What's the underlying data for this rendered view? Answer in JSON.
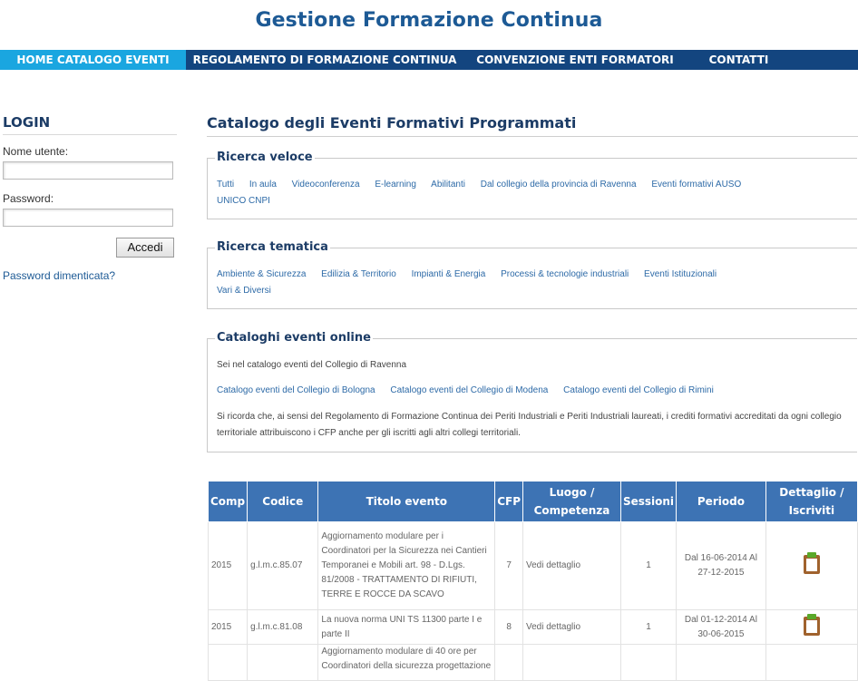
{
  "header": {
    "title": "Gestione Formazione Continua"
  },
  "nav": {
    "items": [
      {
        "label": "HOME CATALOGO EVENTI"
      },
      {
        "label": "REGOLAMENTO DI FORMAZIONE CONTINUA"
      },
      {
        "label": "CONVENZIONE ENTI FORMATORI"
      },
      {
        "label": "CONTATTI"
      }
    ],
    "active_color": "#1aa6e0",
    "bar_color": "#13457f"
  },
  "login": {
    "title": "LOGIN",
    "username_label": "Nome utente:",
    "username_value": "",
    "password_label": "Password:",
    "password_value": "",
    "submit_label": "Accedi",
    "forgot_label": "Password dimenticata?"
  },
  "main": {
    "title": "Catalogo degli Eventi Formativi Programmati",
    "quick_search": {
      "legend": "Ricerca veloce",
      "links": [
        "Tutti",
        "In aula",
        "Videoconferenza",
        "E-learning",
        "Abilitanti",
        "Dal collegio della provincia di Ravenna",
        "Eventi formativi AUSO",
        "UNICO CNPI"
      ]
    },
    "thematic_search": {
      "legend": "Ricerca tematica",
      "links": [
        "Ambiente & Sicurezza",
        "Edilizia & Territorio",
        "Impianti & Energia",
        "Processi & tecnologie industriali",
        "Eventi Istituzionali",
        "Vari & Diversi"
      ]
    },
    "online_catalogs": {
      "legend": "Cataloghi eventi online",
      "intro": "Sei nel catalogo eventi del Collegio di Ravenna",
      "links": [
        "Catalogo eventi del Collegio di Bologna",
        "Catalogo eventi del Collegio di Modena",
        "Catalogo eventi del Collegio di Rimini"
      ],
      "note": "Si ricorda che, ai sensi del Regolamento di Formazione Continua dei Periti Industriali e Periti Industriali laureati, i crediti formativi accreditati da ogni collegio territoriale attribuiscono i CFP anche per gli iscritti agli altri collegi territoriali."
    }
  },
  "table": {
    "headers": [
      "Comp",
      "Codice",
      "Titolo evento",
      "CFP",
      "Luogo / Competenza",
      "Sessioni",
      "Periodo",
      "Dettaglio / Iscriviti"
    ],
    "rows": [
      {
        "comp": "2015",
        "codice": "g.l.m.c.85.07",
        "titolo": "Aggiornamento modulare per i Coordinatori per la Sicurezza nei Cantieri Temporanei e Mobili art. 98 - D.Lgs. 81/2008 - TRATTAMENTO DI RIFIUTI, TERRE E ROCCE DA SCAVO",
        "cfp": "7",
        "luogo": "Vedi dettaglio",
        "sessioni": "1",
        "periodo": "Dal 16-06-2014 Al 27-12-2015"
      },
      {
        "comp": "2015",
        "codice": "g.l.m.c.81.08",
        "titolo": "La nuova norma UNI TS 11300 parte I e parte II",
        "cfp": "8",
        "luogo": "Vedi dettaglio",
        "sessioni": "1",
        "periodo": "Dal 01-12-2014 Al 30-06-2015"
      },
      {
        "comp": "",
        "codice": "",
        "titolo": "Aggiornamento modulare di 40 ore per Coordinatori della sicurezza progettazione",
        "cfp": "",
        "luogo": "",
        "sessioni": "",
        "periodo": ""
      }
    ],
    "header_color": "#3d73b4"
  }
}
